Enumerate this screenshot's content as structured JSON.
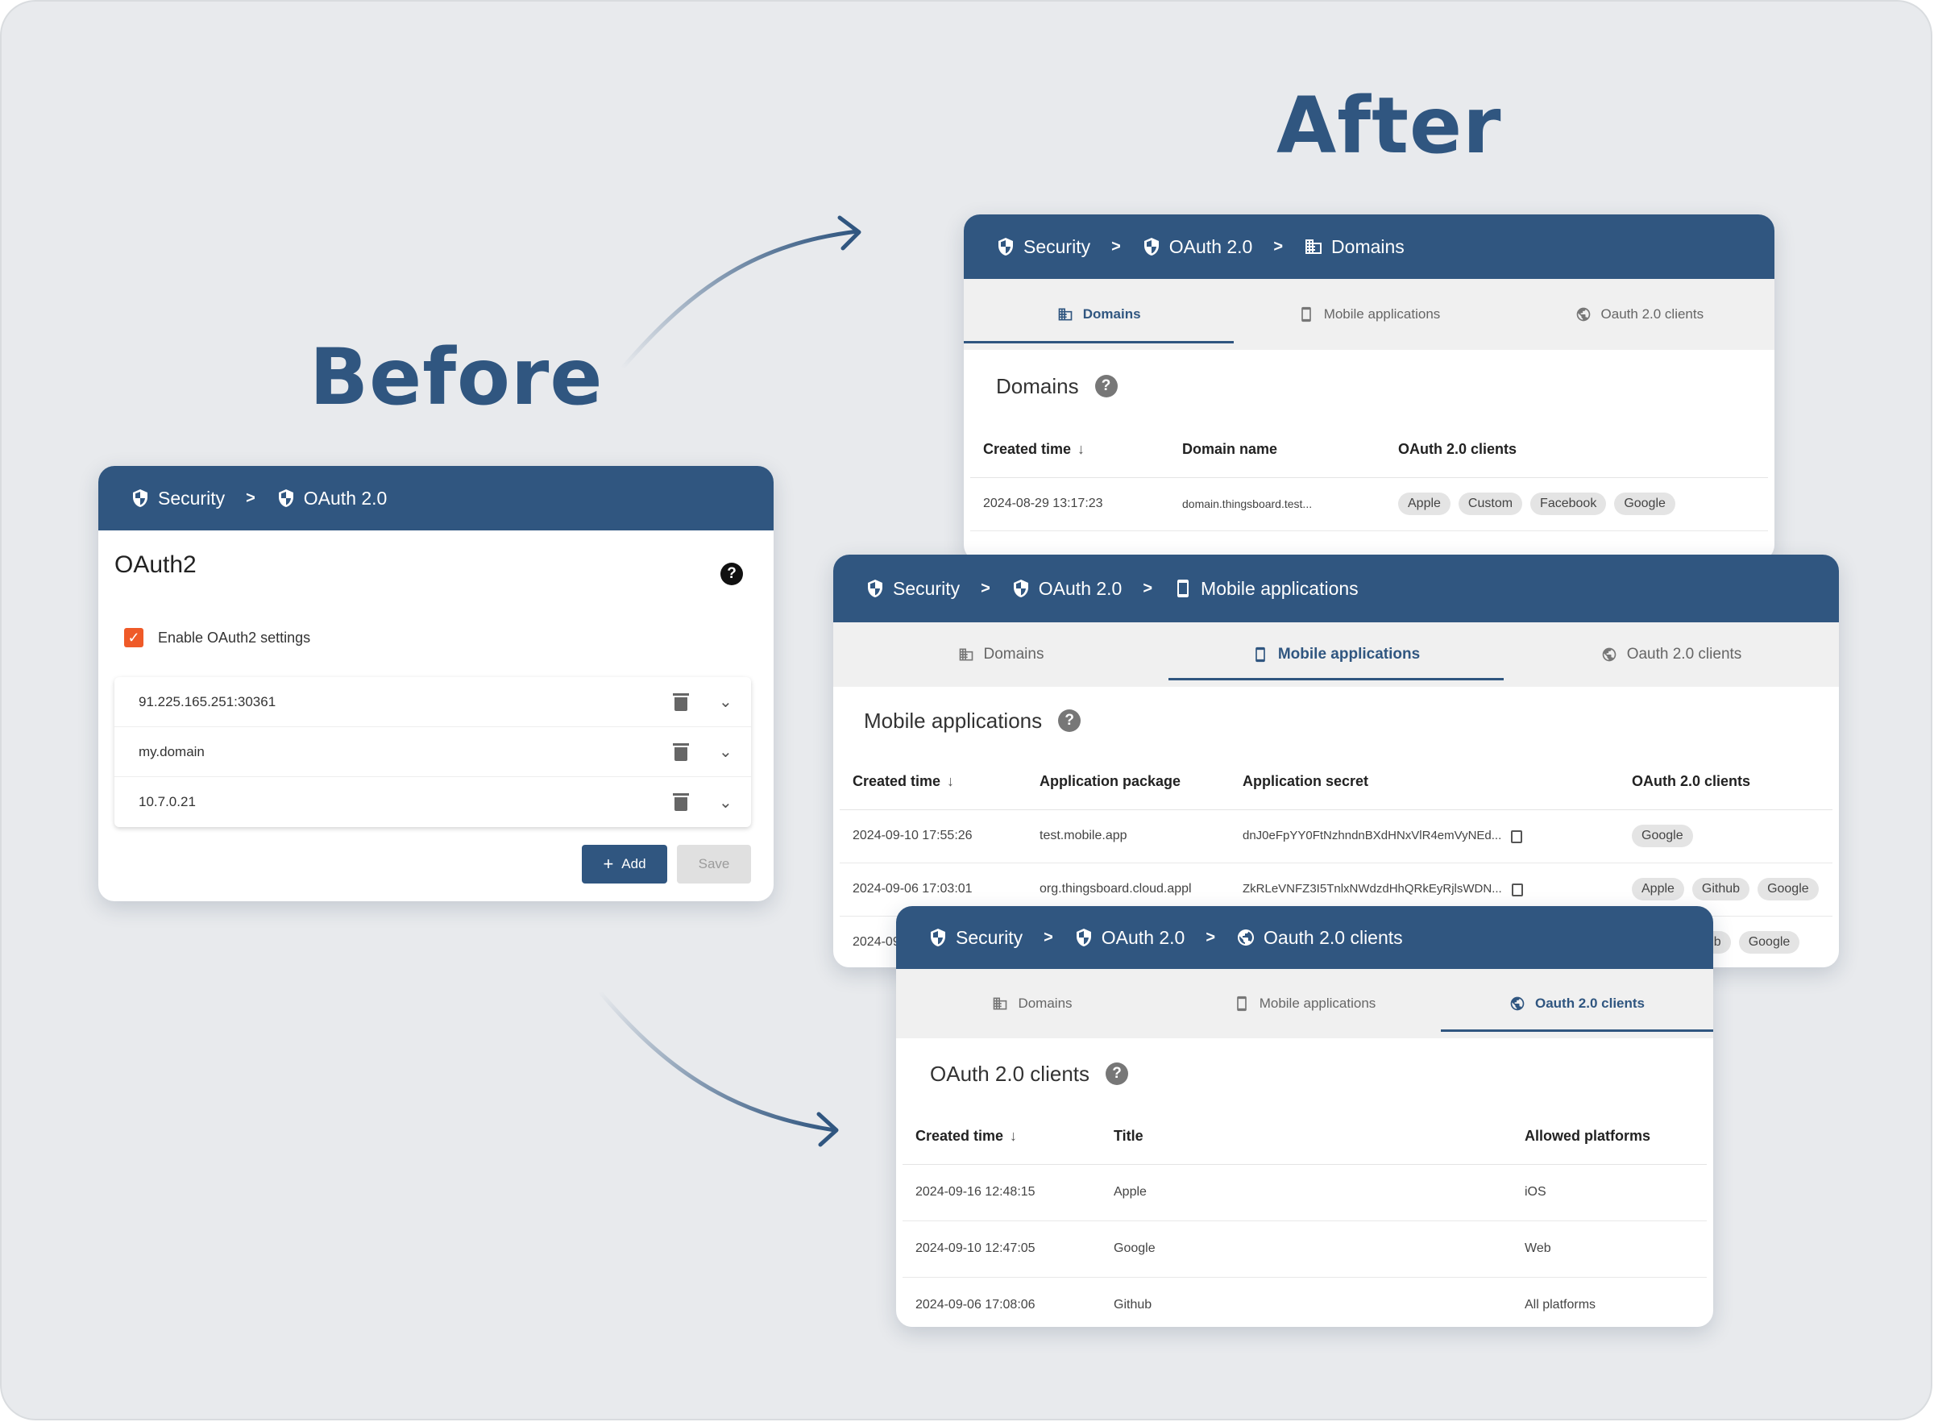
{
  "headings": {
    "before": "Before",
    "after": "After"
  },
  "before_card": {
    "breadcrumb": [
      "Security",
      "OAuth 2.0"
    ],
    "title": "OAuth2",
    "help": "?",
    "enable_label": "Enable OAuth2 settings",
    "enable_checked": true,
    "domains": [
      "91.225.165.251:30361",
      "my.domain",
      "10.7.0.21"
    ],
    "add_label": "Add",
    "save_label": "Save"
  },
  "domains_card": {
    "breadcrumb": [
      "Security",
      "OAuth 2.0",
      "Domains"
    ],
    "tabs": [
      "Domains",
      "Mobile applications",
      "Oauth 2.0 clients"
    ],
    "active_tab": 0,
    "title": "Domains",
    "columns": [
      "Created time",
      "Domain name",
      "OAuth 2.0 clients"
    ],
    "rows": [
      {
        "created": "2024-08-29 13:17:23",
        "domain": "domain.thingsboard.test...",
        "clients": [
          "Apple",
          "Custom",
          "Facebook",
          "Google"
        ]
      }
    ]
  },
  "mobile_card": {
    "breadcrumb": [
      "Security",
      "OAuth 2.0",
      "Mobile applications"
    ],
    "tabs": [
      "Domains",
      "Mobile applications",
      "Oauth 2.0 clients"
    ],
    "active_tab": 1,
    "title": "Mobile applications",
    "columns": [
      "Created time",
      "Application package",
      "Application secret",
      "OAuth 2.0 clients"
    ],
    "rows": [
      {
        "created": "2024-09-10 17:55:26",
        "package": "test.mobile.app",
        "secret": "dnJ0eFpYY0FtNzhndnBXdHNxVlR4emVyNEd...",
        "clients": [
          "Google"
        ]
      },
      {
        "created": "2024-09-06 17:03:01",
        "package": "org.thingsboard.cloud.appl",
        "secret": "ZkRLeVNFZ3I5TnlxNWdzdHhQRkEyRjlsWDN...",
        "clients": [
          "Apple",
          "Github",
          "Google"
        ]
      },
      {
        "created": "2024-09",
        "package": "",
        "secret": "",
        "clients": [
          "hub",
          "Google"
        ]
      }
    ]
  },
  "clients_card": {
    "breadcrumb": [
      "Security",
      "OAuth 2.0",
      "Oauth 2.0 clients"
    ],
    "tabs": [
      "Domains",
      "Mobile applications",
      "Oauth 2.0 clients"
    ],
    "active_tab": 2,
    "title": "OAuth 2.0 clients",
    "columns": [
      "Created time",
      "Title",
      "Allowed platforms"
    ],
    "rows": [
      {
        "created": "2024-09-16 12:48:15",
        "title": "Apple",
        "platforms": "iOS"
      },
      {
        "created": "2024-09-10 12:47:05",
        "title": "Google",
        "platforms": "Web"
      },
      {
        "created": "2024-09-06 17:08:06",
        "title": "Github",
        "platforms": "All platforms"
      }
    ]
  },
  "colors": {
    "brand": "#305680",
    "checkbox": "#ef5a28",
    "background": "#e8eaed"
  }
}
